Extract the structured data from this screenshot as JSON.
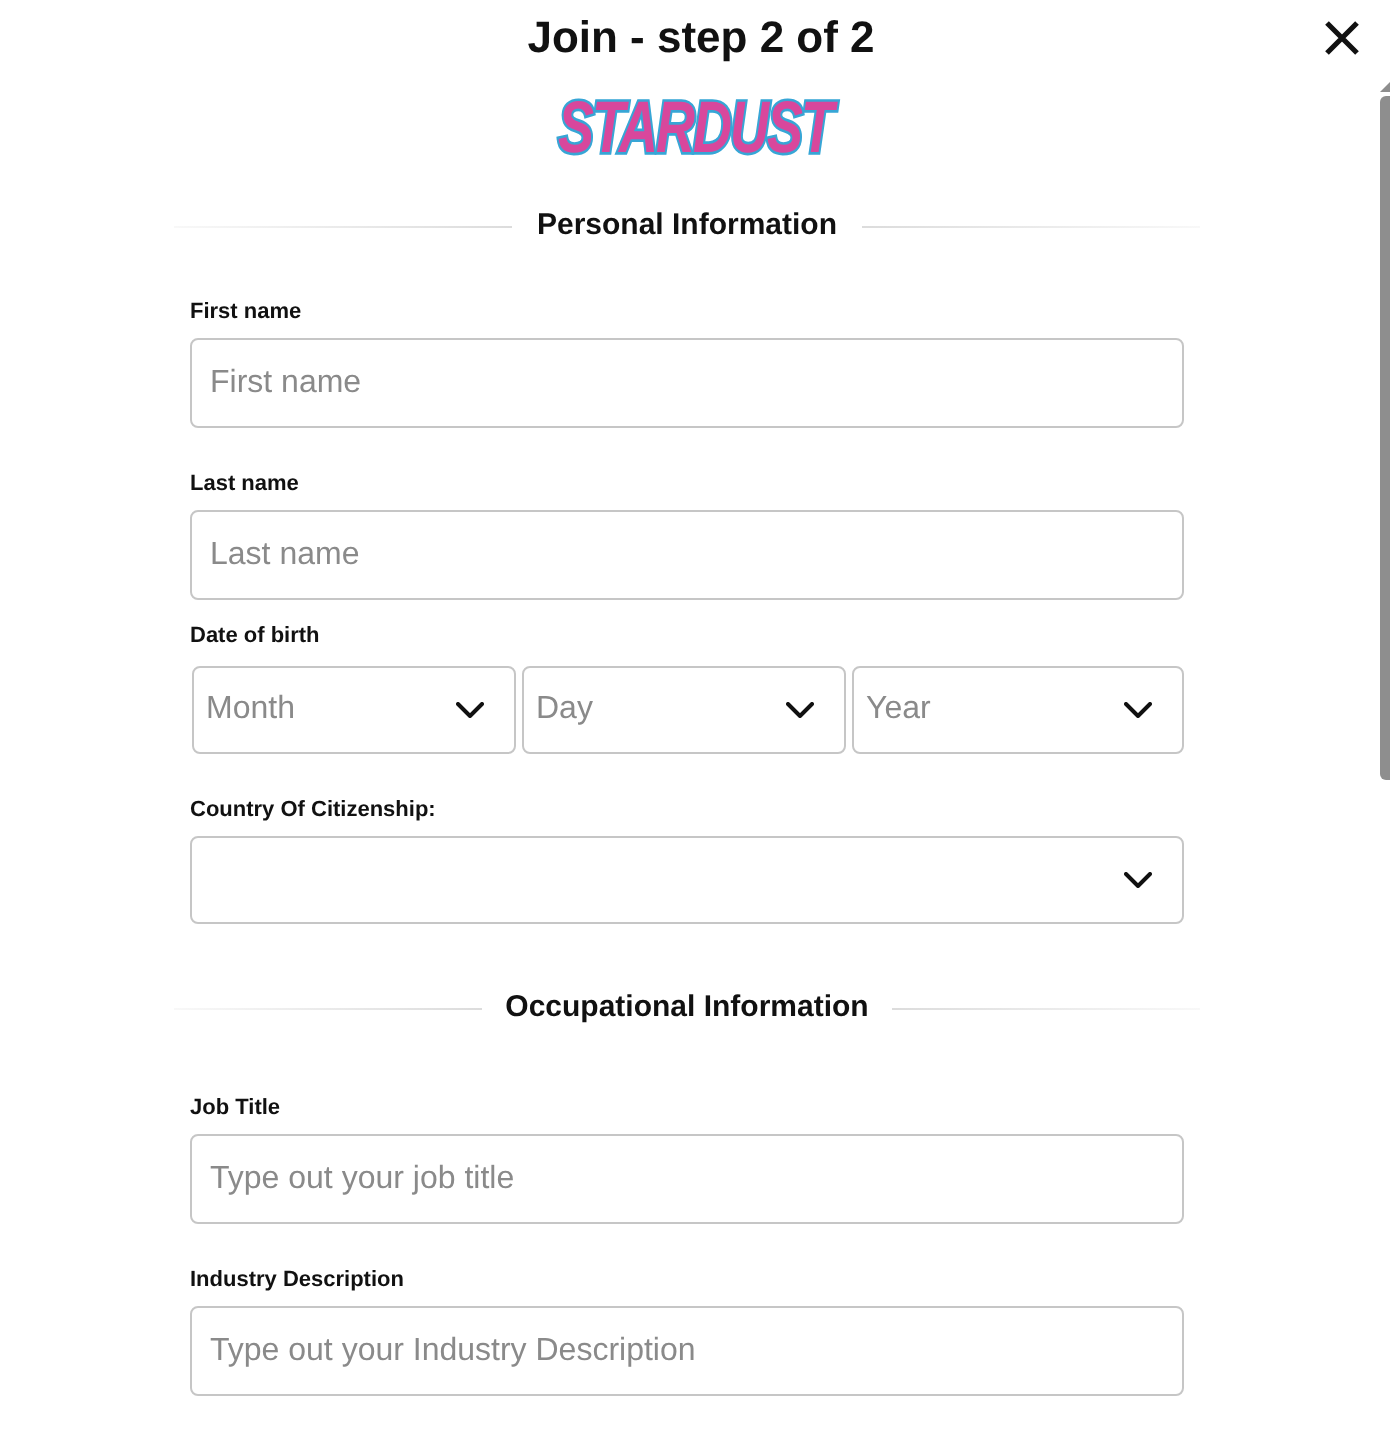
{
  "header": {
    "title": "Join - step 2 of 2",
    "logo_text": "STARDUST"
  },
  "sections": [
    {
      "title": "Personal Information",
      "fields": [
        {
          "kind": "text",
          "label": "First name",
          "placeholder": "First name"
        },
        {
          "kind": "text",
          "label": "Last name",
          "placeholder": "Last name"
        },
        {
          "kind": "date",
          "label": "Date of birth",
          "selects": [
            {
              "placeholder": "Month"
            },
            {
              "placeholder": "Day"
            },
            {
              "placeholder": "Year"
            }
          ]
        },
        {
          "kind": "select",
          "label": "Country Of Citizenship:"
        }
      ]
    },
    {
      "title": "Occupational Information",
      "fields": [
        {
          "kind": "text",
          "label": "Job Title",
          "placeholder": "Type out your job title"
        },
        {
          "kind": "text",
          "label": "Industry Description",
          "placeholder": "Type out your Industry Description"
        }
      ]
    }
  ]
}
